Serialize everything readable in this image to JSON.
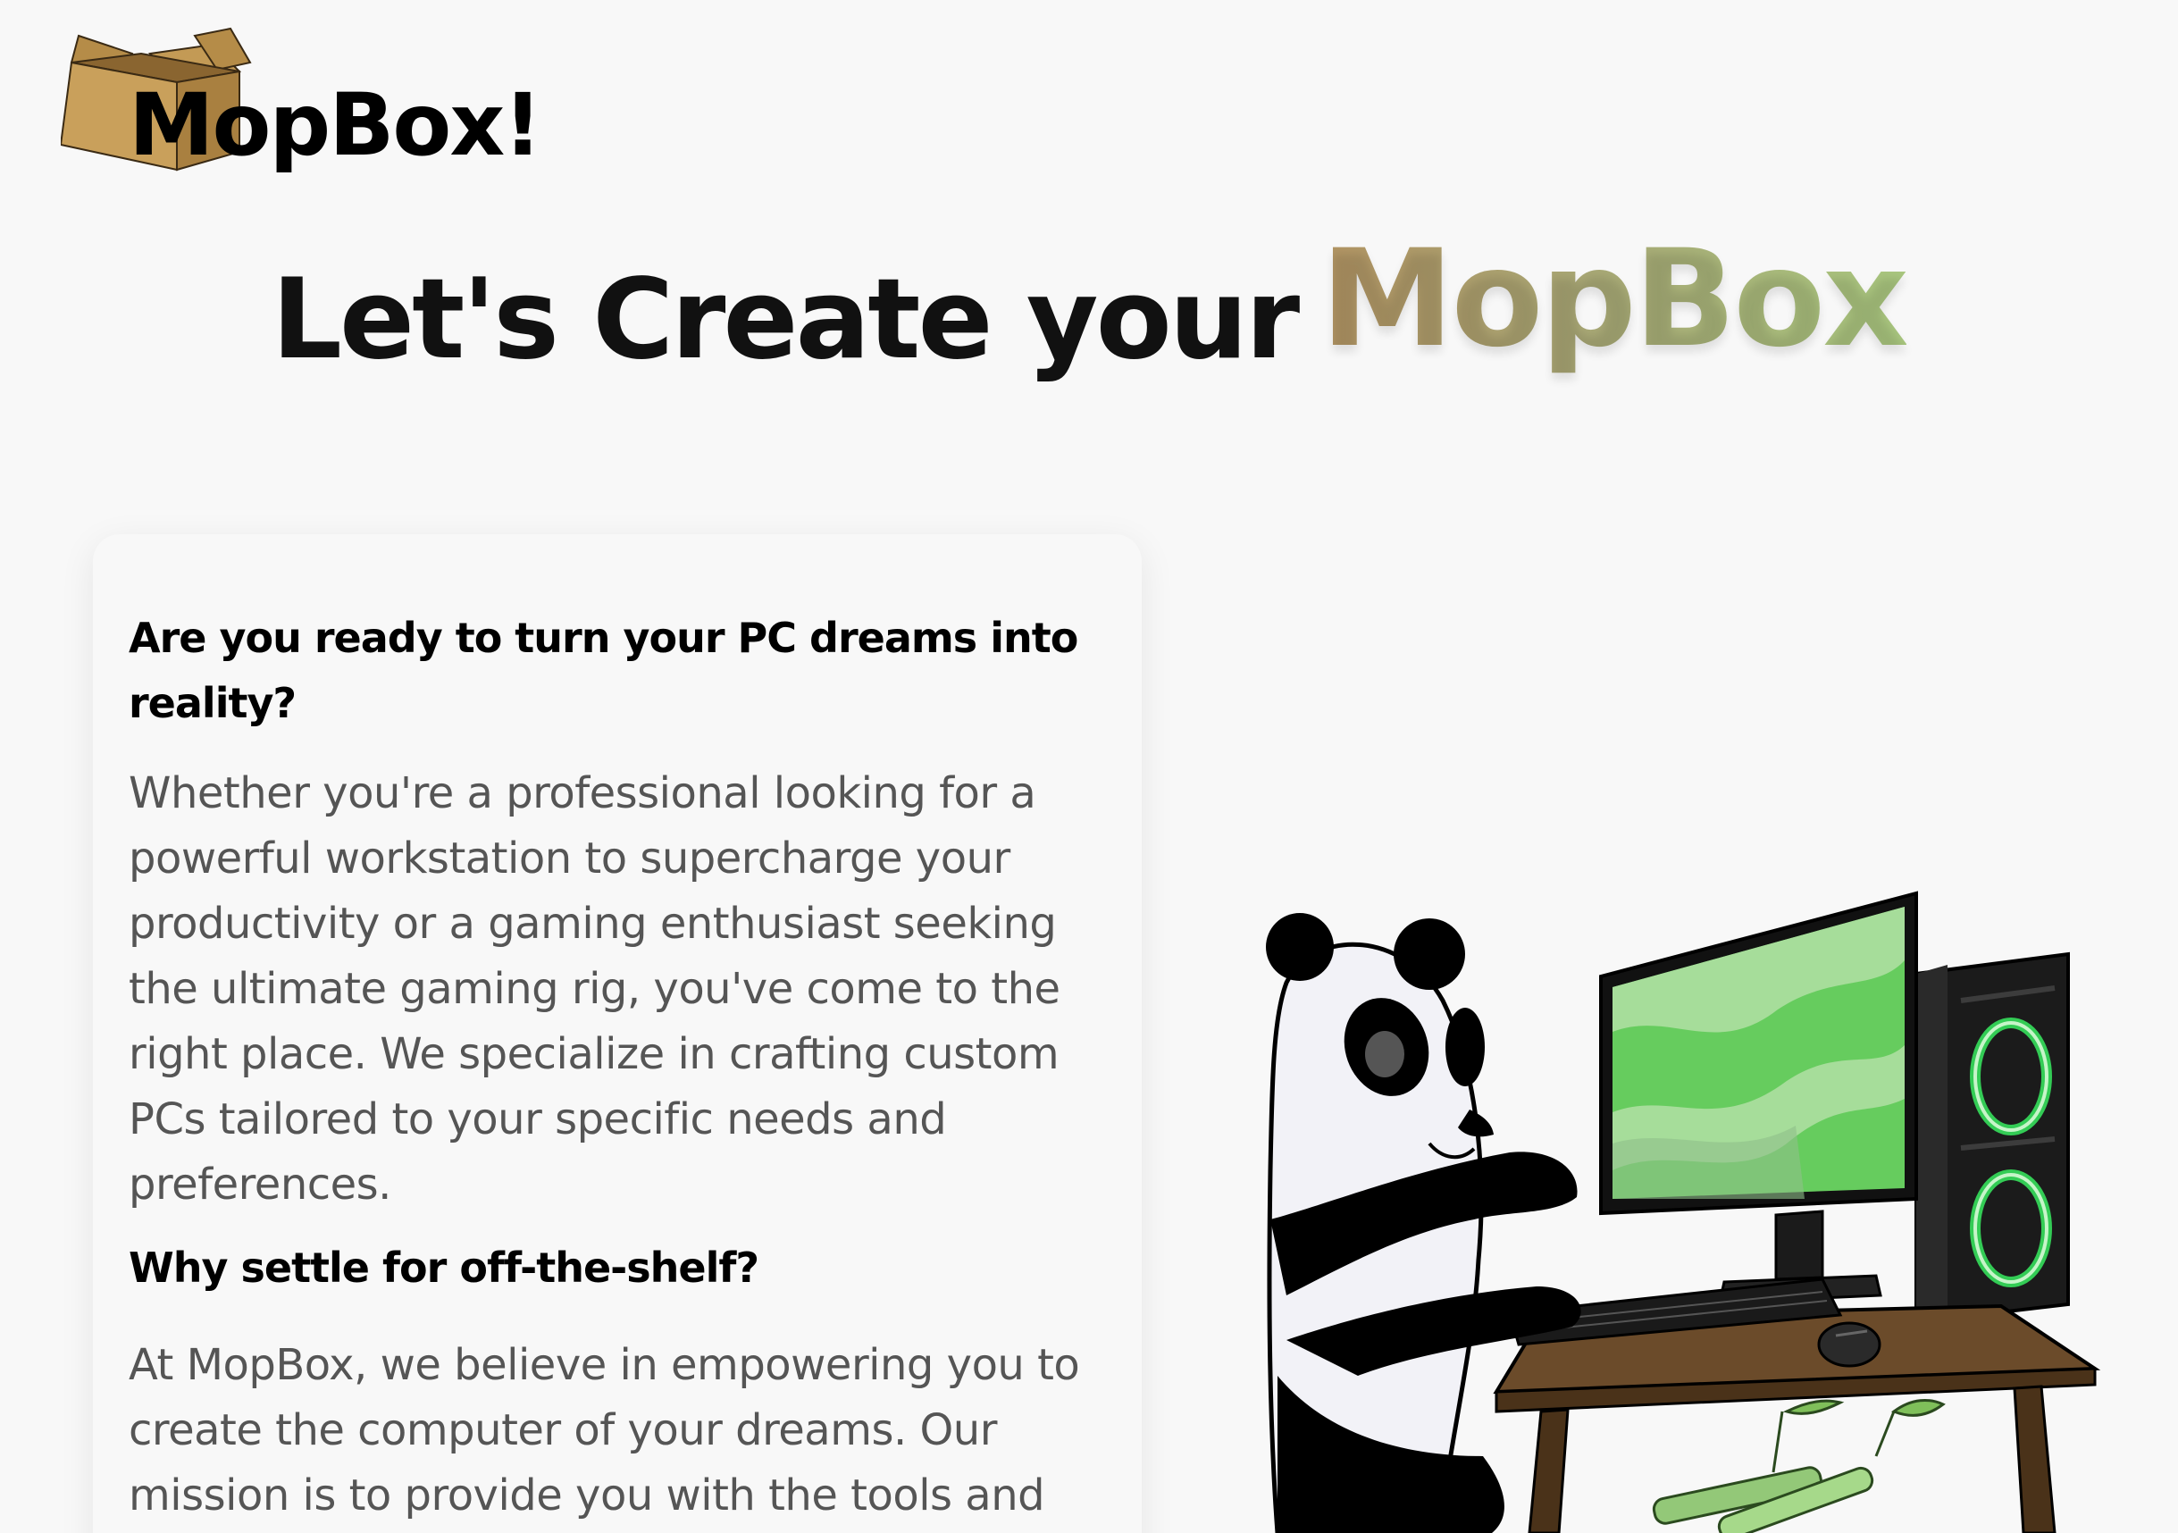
{
  "logo": {
    "text": "MopBox!"
  },
  "hero": {
    "prefix": "Let's Create your",
    "brand": "MopBox"
  },
  "card": {
    "heading_1": "Are you ready to turn your PC dreams into reality?",
    "paragraph_1": "Whether you're a professional looking for a powerful workstation to supercharge your productivity or a gaming enthusiast seeking the ultimate gaming rig, you've come to the right place. We specialize in crafting custom PCs tailored to your specific needs and preferences.",
    "heading_2": "Why settle for off-the-shelf?",
    "paragraph_2": "At MopBox, we believe in empowering you to create the computer of your dreams. Our mission is to provide you with the tools and"
  },
  "icons": {
    "logo_box": "cardboard-box-icon",
    "illustration": "panda-at-computer-illustration"
  },
  "colors": {
    "background": "#f8f8f8",
    "heading": "#111111",
    "body_text": "#555555",
    "brand_gradient_start": "#b29463",
    "brand_gradient_end": "#a9c77f",
    "screen_green": "#66cc5e",
    "case_ring_green": "#33cc55"
  }
}
